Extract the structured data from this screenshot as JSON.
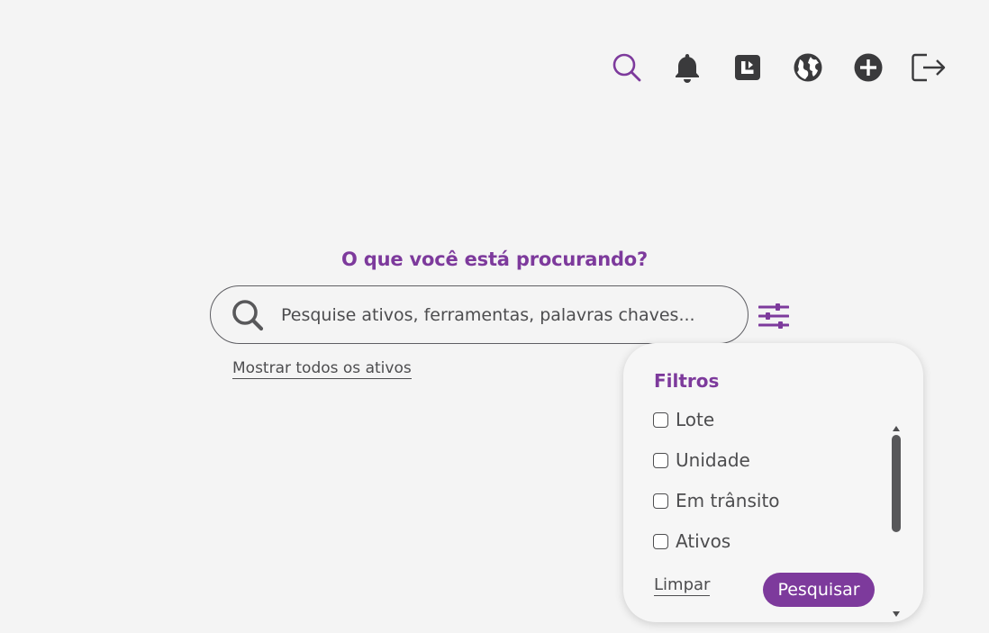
{
  "colors": {
    "accent": "#7d3a9c",
    "text": "#4d4d4f",
    "icon_dark": "#3a3a3c",
    "background": "#f4f4f4"
  },
  "topbar": {
    "icons": [
      "search-icon",
      "bell-icon",
      "dashboard-icon",
      "globe-icon",
      "plus-circle-icon",
      "logout-icon"
    ]
  },
  "main": {
    "heading": "O que você está procurando?",
    "search_placeholder": "Pesquise ativos, ferramentas, palavras chaves...",
    "show_all_link": "Mostrar todos os ativos"
  },
  "filters": {
    "title": "Filtros",
    "options": [
      {
        "label": "Lote",
        "checked": false
      },
      {
        "label": "Unidade",
        "checked": false
      },
      {
        "label": "Em trânsito",
        "checked": false
      },
      {
        "label": "Ativos",
        "checked": false
      }
    ],
    "clear_label": "Limpar",
    "submit_label": "Pesquisar"
  }
}
